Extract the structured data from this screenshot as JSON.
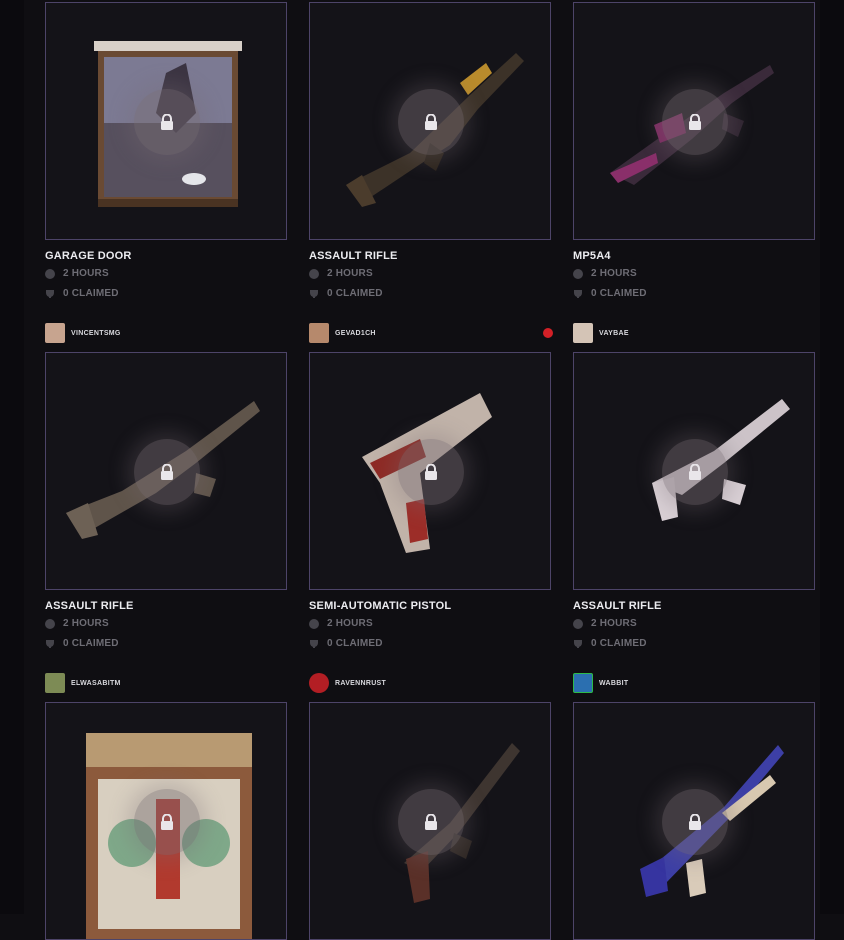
{
  "cards": [
    {
      "creator": null,
      "title": "GARAGE DOOR",
      "duration": "2 HOURS",
      "claimed": "0 CLAIMED",
      "item_icon": "garage-door-painting",
      "locked": true
    },
    {
      "creator": null,
      "title": "ASSAULT RIFLE",
      "duration": "2 HOURS",
      "claimed": "0 CLAIMED",
      "item_icon": "assault-rifle-gold",
      "locked": true
    },
    {
      "creator": null,
      "title": "MP5A4",
      "duration": "2 HOURS",
      "claimed": "0 CLAIMED",
      "item_icon": "mp5a4-pink",
      "locked": true
    },
    {
      "creator": "VINCENTSMG",
      "title": "ASSAULT RIFLE",
      "duration": "2 HOURS",
      "claimed": "0 CLAIMED",
      "item_icon": "assault-rifle-tan",
      "locked": true
    },
    {
      "creator": "GEVAD1CH",
      "live": true,
      "title": "SEMI-AUTOMATIC PISTOL",
      "duration": "2 HOURS",
      "claimed": "0 CLAIMED",
      "item_icon": "pistol-bloody",
      "locked": true
    },
    {
      "creator": "VAYBAE",
      "title": "ASSAULT RIFLE",
      "duration": "2 HOURS",
      "claimed": "0 CLAIMED",
      "item_icon": "assault-rifle-white",
      "locked": true
    },
    {
      "creator": "ELWASABITM",
      "title": "",
      "item_icon": "wooden-door-decorated",
      "locked": true
    },
    {
      "creator": "RAVENNRUST",
      "title": "",
      "item_icon": "assault-rifle-dark",
      "locked": true
    },
    {
      "creator": "WABBIT",
      "title": "",
      "item_icon": "thompson-blue",
      "locked": true
    }
  ],
  "colors": {
    "background": "#0f0e12",
    "card_border": "#4d4468",
    "live_indicator": "#d32027",
    "meta_text": "#6e6d75"
  }
}
